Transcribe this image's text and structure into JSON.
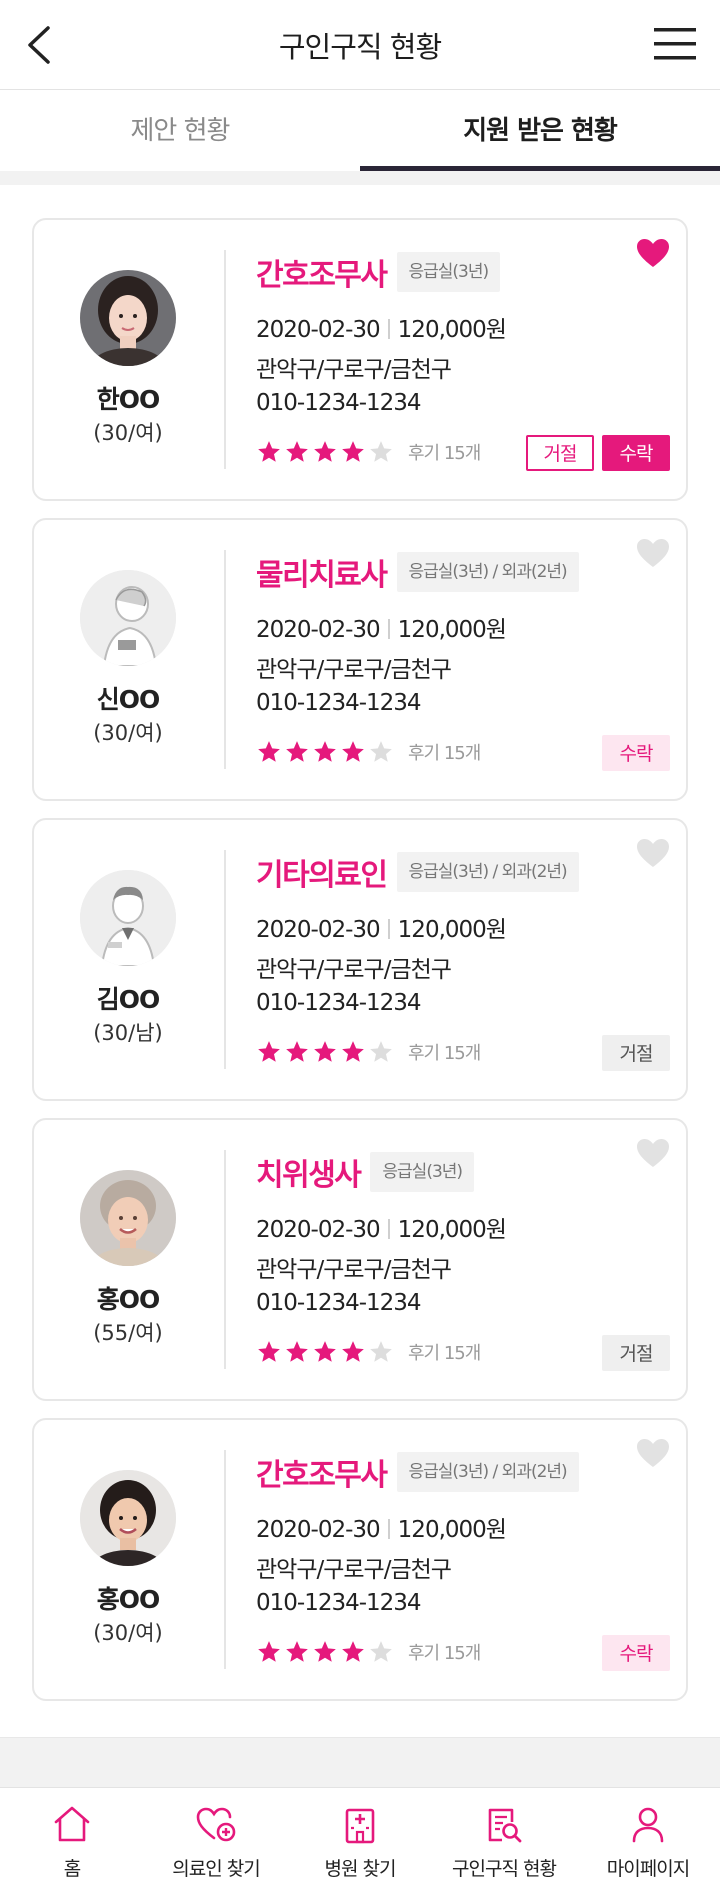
{
  "header": {
    "title": "구인구직 현황"
  },
  "tabs": [
    {
      "label": "제안 현황",
      "active": false
    },
    {
      "label": "지원 받은 현황",
      "active": true
    }
  ],
  "cards": [
    {
      "name": "한OO",
      "info": "(30/여)",
      "job": "간호조무사",
      "dept": "응급실(3년)",
      "date": "2020-02-30",
      "pay": "120,000원",
      "area": "관악구/구로구/금천구",
      "phone": "010-1234-1234",
      "rating": 4,
      "reviews": "후기 15개",
      "favorite": true,
      "reject_label": "거절",
      "accept_label": "수락",
      "status": "pending",
      "avatar_style": "woman-photo"
    },
    {
      "name": "신OO",
      "info": "(30/여)",
      "job": "물리치료사",
      "dept": "응급실(3년) / 외과(2년)",
      "date": "2020-02-30",
      "pay": "120,000원",
      "area": "관악구/구로구/금천구",
      "phone": "010-1234-1234",
      "rating": 4,
      "reviews": "후기 15개",
      "favorite": false,
      "status_label": "수락",
      "status": "accepted",
      "avatar_style": "illustration-female"
    },
    {
      "name": "김OO",
      "info": "(30/남)",
      "job": "기타의료인",
      "dept": "응급실(3년) / 외과(2년)",
      "date": "2020-02-30",
      "pay": "120,000원",
      "area": "관악구/구로구/금천구",
      "phone": "010-1234-1234",
      "rating": 4,
      "reviews": "후기 15개",
      "favorite": false,
      "status_label": "거절",
      "status": "rejected",
      "avatar_style": "illustration-male"
    },
    {
      "name": "홍OO",
      "info": "(55/여)",
      "job": "치위생사",
      "dept": "응급실(3년)",
      "date": "2020-02-30",
      "pay": "120,000원",
      "area": "관악구/구로구/금천구",
      "phone": "010-1234-1234",
      "rating": 4,
      "reviews": "후기 15개",
      "favorite": false,
      "status_label": "거절",
      "status": "rejected",
      "avatar_style": "older-woman-photo"
    },
    {
      "name": "홍OO",
      "info": "(30/여)",
      "job": "간호조무사",
      "dept": "응급실(3년) / 외과(2년)",
      "date": "2020-02-30",
      "pay": "120,000원",
      "area": "관악구/구로구/금천구",
      "phone": "010-1234-1234",
      "rating": 4,
      "reviews": "후기 15개",
      "favorite": false,
      "status_label": "수락",
      "status": "accepted",
      "avatar_style": "woman-photo-2"
    }
  ],
  "bottom_nav": [
    {
      "label": "홈",
      "icon": "home-icon"
    },
    {
      "label": "의료인 찾기",
      "icon": "heart-plus-icon"
    },
    {
      "label": "병원 찾기",
      "icon": "hospital-icon"
    },
    {
      "label": "구인구직 현황",
      "icon": "document-search-icon"
    },
    {
      "label": "마이페이지",
      "icon": "person-icon"
    }
  ],
  "colors": {
    "accent": "#e5197c",
    "text": "#222222",
    "muted": "#9a9a9a",
    "star_empty": "#dddddd"
  }
}
